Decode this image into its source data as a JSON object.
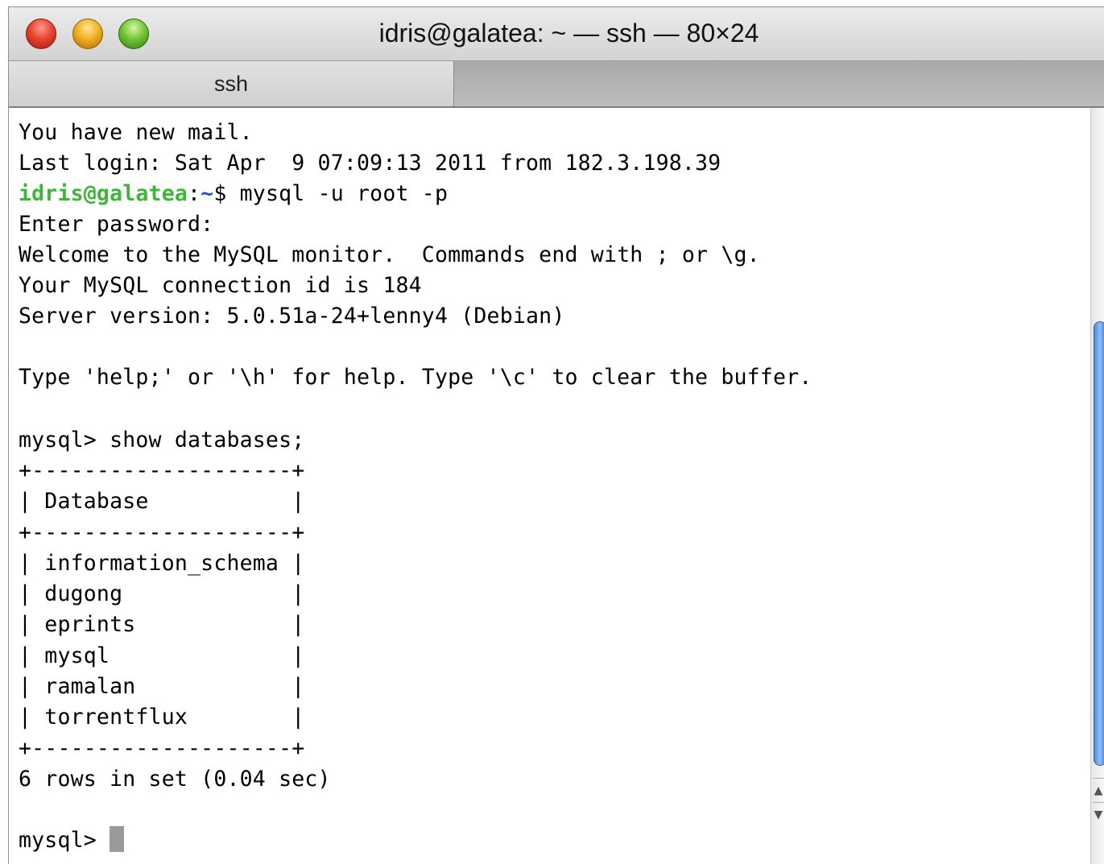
{
  "window": {
    "title": "idris@galatea: ~ — ssh — 80×24",
    "tabs": [
      {
        "label": "ssh"
      }
    ]
  },
  "terminal": {
    "lines": [
      "You have new mail.",
      "Last login: Sat Apr  9 07:09:13 2011 from 182.3.198.39",
      "",
      "Enter password:",
      "Welcome to the MySQL monitor.  Commands end with ; or \\g.",
      "Your MySQL connection id is 184",
      "Server version: 5.0.51a-24+lenny4 (Debian)",
      "",
      "Type 'help;' or '\\h' for help. Type '\\c' to clear the buffer.",
      "",
      "mysql> show databases;",
      "+--------------------+",
      "| Database           |",
      "+--------------------+",
      "| information_schema |",
      "| dugong             |",
      "| eprints            |",
      "| mysql              |",
      "| ramalan            |",
      "| torrentflux        |",
      "+--------------------+",
      "6 rows in set (0.04 sec)",
      ""
    ],
    "shell_prompt": {
      "user_host": "idris@galatea",
      "separator": ":",
      "path": "~",
      "symbol": "$",
      "command": " mysql -u root -p"
    },
    "final_prompt": "mysql> "
  },
  "colors": {
    "prompt_user": "#3cb834",
    "prompt_path": "#2b4ed1",
    "cursor": "#9a9a9a"
  },
  "icons": {
    "close": "close-icon",
    "minimize": "minimize-icon",
    "zoom": "zoom-icon"
  }
}
